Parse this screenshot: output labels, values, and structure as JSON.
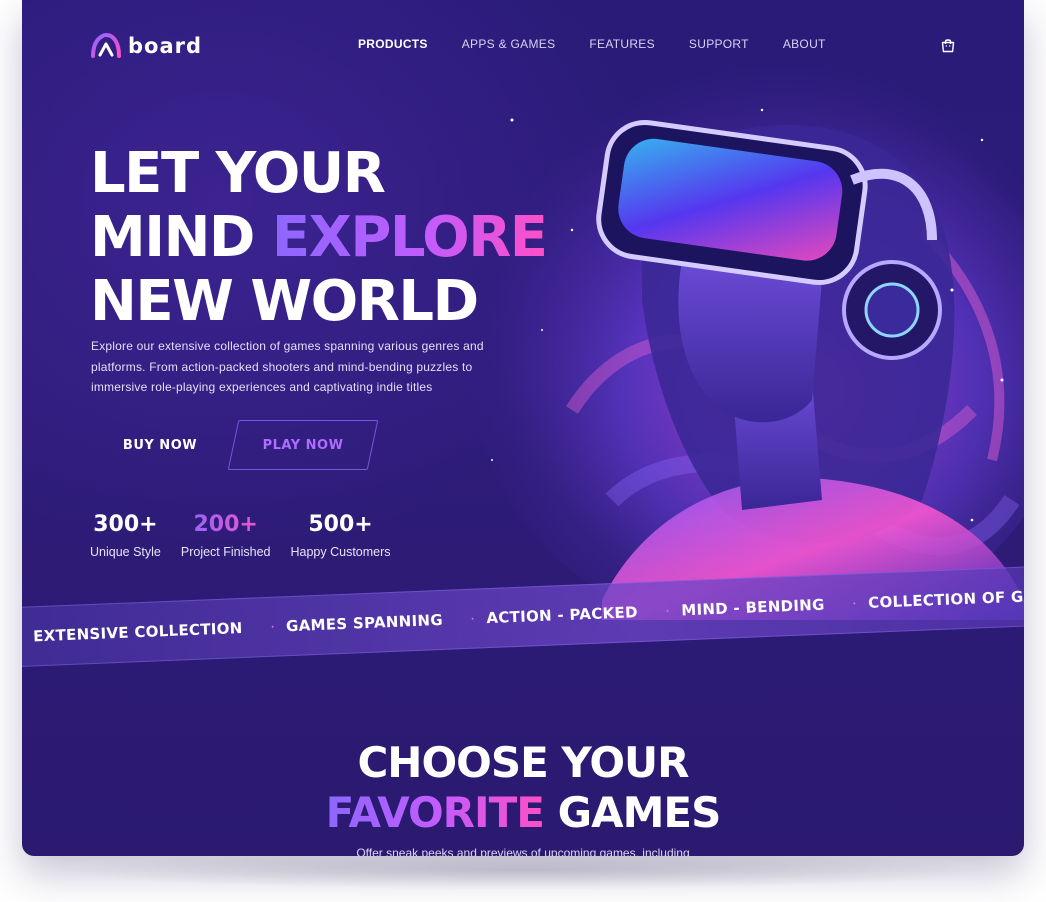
{
  "brand": {
    "name": "board"
  },
  "nav": {
    "items": [
      "PRODUCTS",
      "APPS & GAMES",
      "FEATURES",
      "SUPPORT",
      "ABOUT"
    ],
    "active": "PRODUCTS",
    "cart_icon": "shopping-bag-icon"
  },
  "hero": {
    "line1": "LET YOUR",
    "line2_a": "MIND ",
    "line2_b": "EXPLORE",
    "line3": "NEW WORLD",
    "description": "Explore our extensive collection of games spanning various genres and platforms. From action-packed shooters and mind-bending puzzles to immersive role-playing experiences and captivating indie titles",
    "buy_label": "BUY NOW",
    "play_label": "PLAY NOW",
    "image": "vr-headset-woman-illustration"
  },
  "stats": [
    {
      "value": "300+",
      "label": "Unique Style"
    },
    {
      "value": "200+",
      "label": "Project Finished"
    },
    {
      "value": "500+",
      "label": "Happy Customers"
    }
  ],
  "ticker": [
    "EXTENSIVE COLLECTION",
    "GAMES SPANNING",
    "ACTION - PACKED",
    "MIND - BENDING",
    "COLLECTION OF GAMES"
  ],
  "section": {
    "title_line1": "CHOOSE YOUR",
    "title_line2_a": "FAVORITE",
    "title_line2_b": " GAMES",
    "subtitle": "Offer sneak peeks and previews of upcoming games, including"
  },
  "colors": {
    "accent_start": "#8c67ff",
    "accent_end": "#ff4fc6",
    "background": "#2c1b76"
  }
}
